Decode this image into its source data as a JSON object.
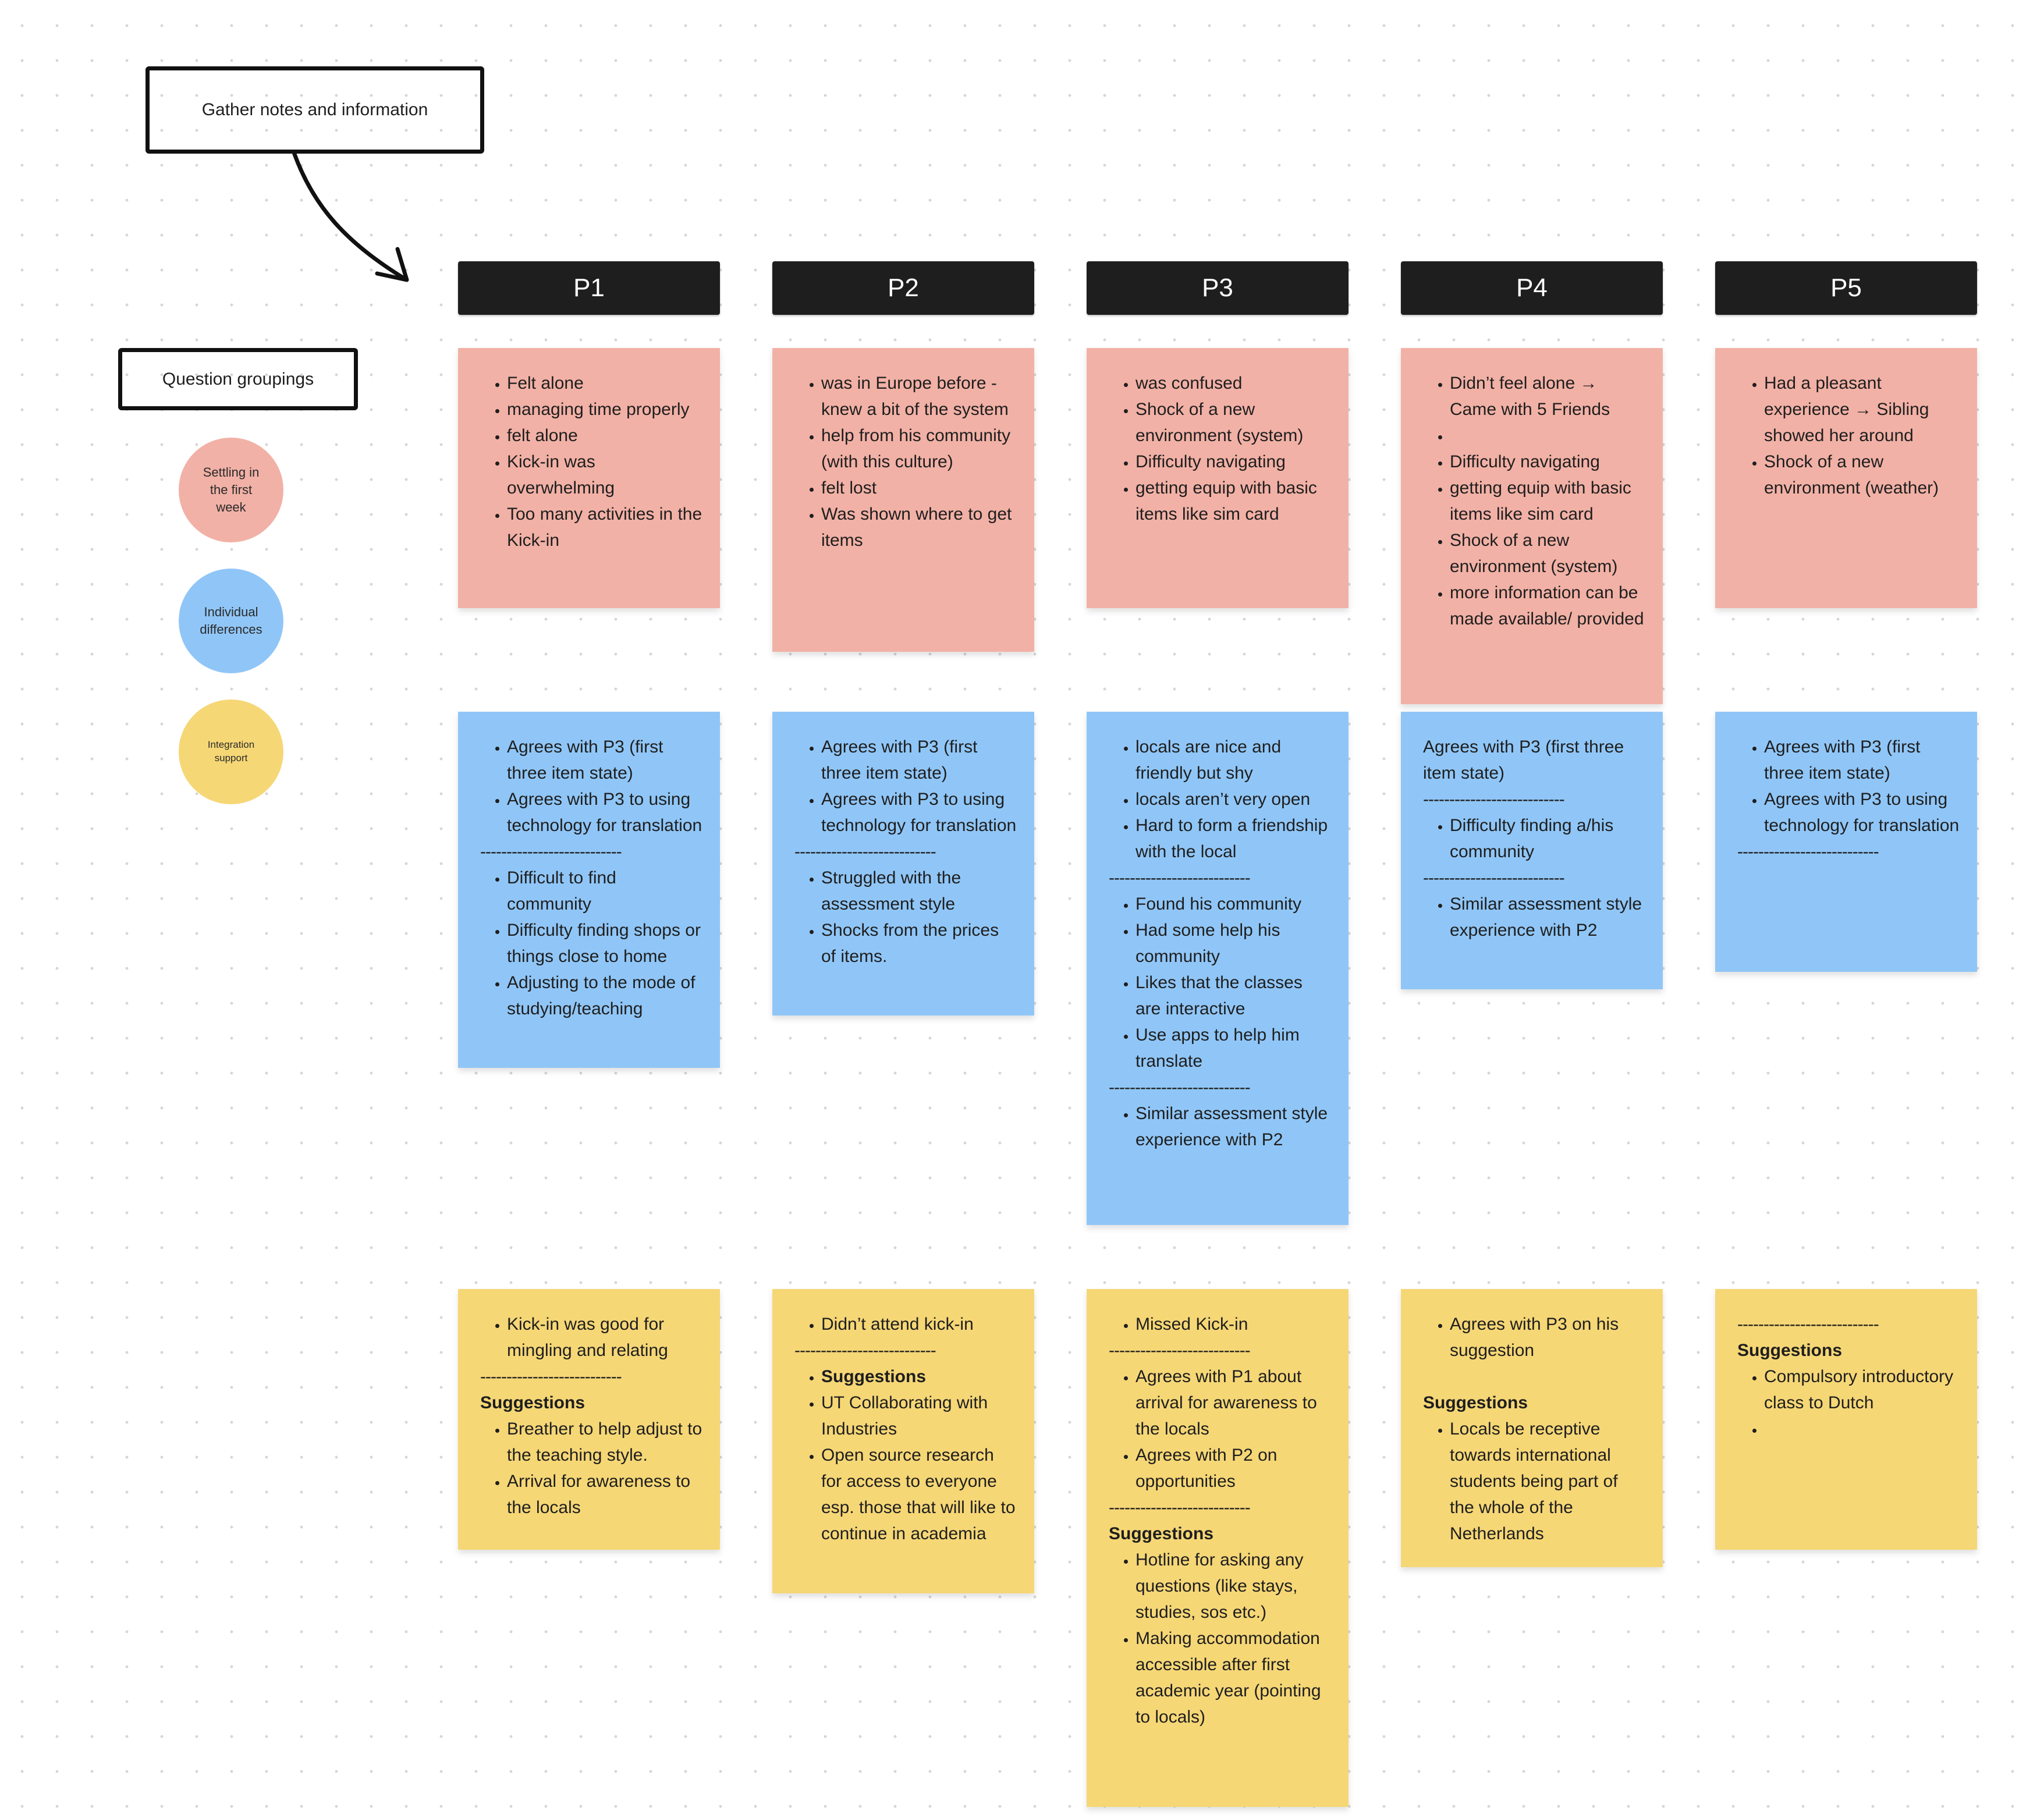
{
  "annotations": {
    "gather_label": "Gather notes and information",
    "groupings_label": "Question groupings"
  },
  "legend": [
    {
      "label": "Settling in the first week",
      "lines": [
        "Settling in",
        "the first",
        "week"
      ],
      "color": "#f2b1a6"
    },
    {
      "label": "Individual differences",
      "lines": [
        "Individual",
        "differences"
      ],
      "color": "#90c6f7"
    },
    {
      "label": "Integration support",
      "lines": [
        "Integration",
        "support"
      ],
      "color": "#f6d776"
    }
  ],
  "colors": {
    "header_bg": "#1e1e1e",
    "pink": "#f2b1a6",
    "blue": "#90c6f7",
    "yellow": "#f6d776"
  },
  "separator": "---------------------------",
  "columns": [
    {
      "header": "P1",
      "settling": [
        {
          "type": "list",
          "items": [
            "Felt alone",
            "managing  time properly",
            "felt alone",
            "Kick-in was overwhelming",
            "Too many activities in the Kick-in"
          ]
        }
      ],
      "differences": [
        {
          "type": "list",
          "items": [
            "Agrees with P3 (first three item state)",
            "Agrees with P3 to using technology for translation"
          ]
        },
        {
          "type": "sep"
        },
        {
          "type": "list",
          "items": [
            "Difficult to find community",
            "Difficulty finding shops or things close to home",
            "Adjusting to the mode of studying/teaching"
          ]
        }
      ],
      "support": [
        {
          "type": "list",
          "items": [
            "Kick-in was good for mingling and relating"
          ]
        },
        {
          "type": "sep"
        },
        {
          "type": "heading",
          "text": "Suggestions"
        },
        {
          "type": "list",
          "items": [
            "Breather to help adjust to the teaching style.",
            "Arrival for awareness to the locals"
          ]
        }
      ]
    },
    {
      "header": "P2",
      "settling": [
        {
          "type": "list",
          "items": [
            "was in Europe before - knew a bit of the system",
            "help from his community (with this culture)",
            "felt lost",
            "Was shown where to get items"
          ]
        }
      ],
      "differences": [
        {
          "type": "list",
          "items": [
            "Agrees with P3 (first three item state)",
            "Agrees with P3 to using technology for translation"
          ]
        },
        {
          "type": "sep"
        },
        {
          "type": "list",
          "items": [
            "Struggled with the assessment style",
            "Shocks from the prices of items."
          ]
        }
      ],
      "support": [
        {
          "type": "list",
          "items": [
            "Didn’t attend kick-in"
          ]
        },
        {
          "type": "sep"
        },
        {
          "type": "list",
          "bold_first": true,
          "items": [
            "Suggestions",
            "UT Collaborating with Industries",
            "Open source research for access to everyone esp. those that will like to continue in academia"
          ]
        }
      ]
    },
    {
      "header": "P3",
      "settling": [
        {
          "type": "list",
          "items": [
            "was confused",
            "Shock of a new environment (system)",
            "Difficulty navigating",
            "getting equip with basic items like sim card"
          ]
        }
      ],
      "differences": [
        {
          "type": "list",
          "items": [
            "locals are nice and friendly but shy",
            "locals aren’t very open",
            "Hard to form a friendship with the local"
          ]
        },
        {
          "type": "sep"
        },
        {
          "type": "list",
          "items": [
            "Found his community",
            "Had some help his community",
            "Likes that the classes are interactive",
            "Use apps to help him translate"
          ]
        },
        {
          "type": "sep"
        },
        {
          "type": "list",
          "items": [
            "Similar assessment style experience with P2"
          ]
        }
      ],
      "support": [
        {
          "type": "list",
          "items": [
            "Missed Kick-in"
          ]
        },
        {
          "type": "sep"
        },
        {
          "type": "list",
          "items": [
            "Agrees with P1 about arrival for awareness to the locals",
            "Agrees with P2 on opportunities"
          ]
        },
        {
          "type": "sep"
        },
        {
          "type": "heading",
          "text": "Suggestions"
        },
        {
          "type": "list",
          "items": [
            "Hotline for asking any questions (like stays, studies, sos etc.)",
            "Making accommodation accessible after first academic year (pointing to locals)"
          ]
        }
      ]
    },
    {
      "header": "P4",
      "settling": [
        {
          "type": "list",
          "items": [
            "Didn’t feel alone → Came with 5 Friends",
            "",
            "Difficulty navigating",
            "getting equip with basic items like sim card",
            "Shock of a new environment (system)",
            "more information can be made available/ provided"
          ]
        }
      ],
      "differences": [
        {
          "type": "text",
          "text": "Agrees with P3 (first three item state)"
        },
        {
          "type": "sep"
        },
        {
          "type": "list",
          "items": [
            "Difficulty finding a/his community"
          ]
        },
        {
          "type": "sep"
        },
        {
          "type": "list",
          "items": [
            "Similar assessment style experience with P2"
          ]
        }
      ],
      "support": [
        {
          "type": "list",
          "items": [
            "Agrees with P3 on his suggestion"
          ]
        },
        {
          "type": "blank"
        },
        {
          "type": "heading",
          "text": "Suggestions"
        },
        {
          "type": "list",
          "items": [
            "Locals be receptive towards international students being part of the whole of the Netherlands"
          ]
        }
      ]
    },
    {
      "header": "P5",
      "settling": [
        {
          "type": "list",
          "items": [
            "Had a pleasant experience → Sibling showed her around",
            "Shock of a new environment (weather)"
          ]
        }
      ],
      "differences": [
        {
          "type": "list",
          "items": [
            "Agrees with P3 (first three item state)",
            "Agrees with P3 to using technology for translation"
          ]
        },
        {
          "type": "sep"
        }
      ],
      "support": [
        {
          "type": "sep"
        },
        {
          "type": "heading",
          "text": "Suggestions"
        },
        {
          "type": "list",
          "items": [
            "Compulsory introductory class to Dutch",
            ""
          ]
        }
      ]
    }
  ]
}
